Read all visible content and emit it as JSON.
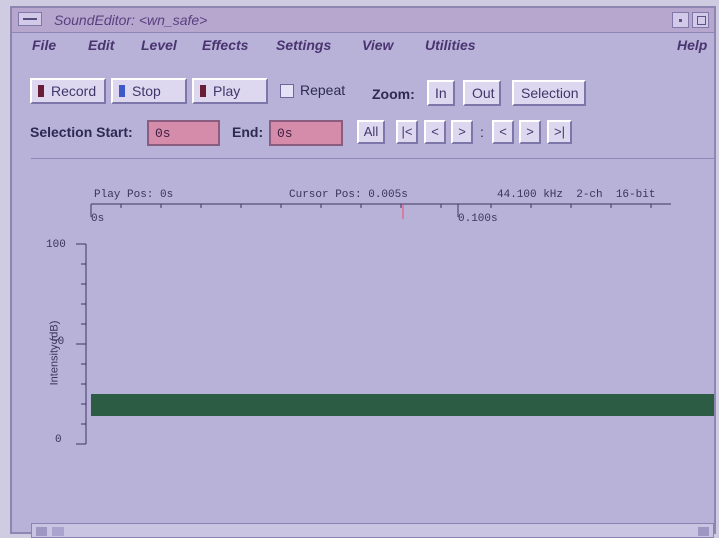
{
  "window": {
    "title": "SoundEditor: <wn_safe>",
    "menu": [
      "File",
      "Edit",
      "Level",
      "Effects",
      "Settings",
      "View",
      "Utilities",
      "Help"
    ]
  },
  "toolbar": {
    "record": "Record",
    "stop": "Stop",
    "play": "Play",
    "repeat": "Repeat",
    "zoom_label": "Zoom:",
    "zoom_in": "In",
    "zoom_out": "Out",
    "selection": "Selection",
    "selection_start_label": "Selection Start:",
    "selection_start_value": "0s",
    "end_label": "End:",
    "end_value": "0s",
    "nav": [
      "All",
      "|<",
      "<",
      ">",
      ":",
      "<",
      ">",
      ">|"
    ]
  },
  "display": {
    "play_pos": "Play Pos: 0s",
    "cursor_pos": "Cursor Pos: 0.005s",
    "format": "44.100 kHz  2-ch  16-bit",
    "axis_start": "0s",
    "axis_mid": "0.100s",
    "y_label": "Intensity (dB)",
    "y_ticks": [
      "100",
      "50",
      "0"
    ]
  },
  "colors": {
    "window_bg": "#b8b2d8",
    "field_bg": "#d58cab",
    "record_icon": "#6a1d36",
    "stop_icon": "#3d59c8",
    "play_icon": "#6a1d36",
    "waveform": "#2c5d44"
  }
}
